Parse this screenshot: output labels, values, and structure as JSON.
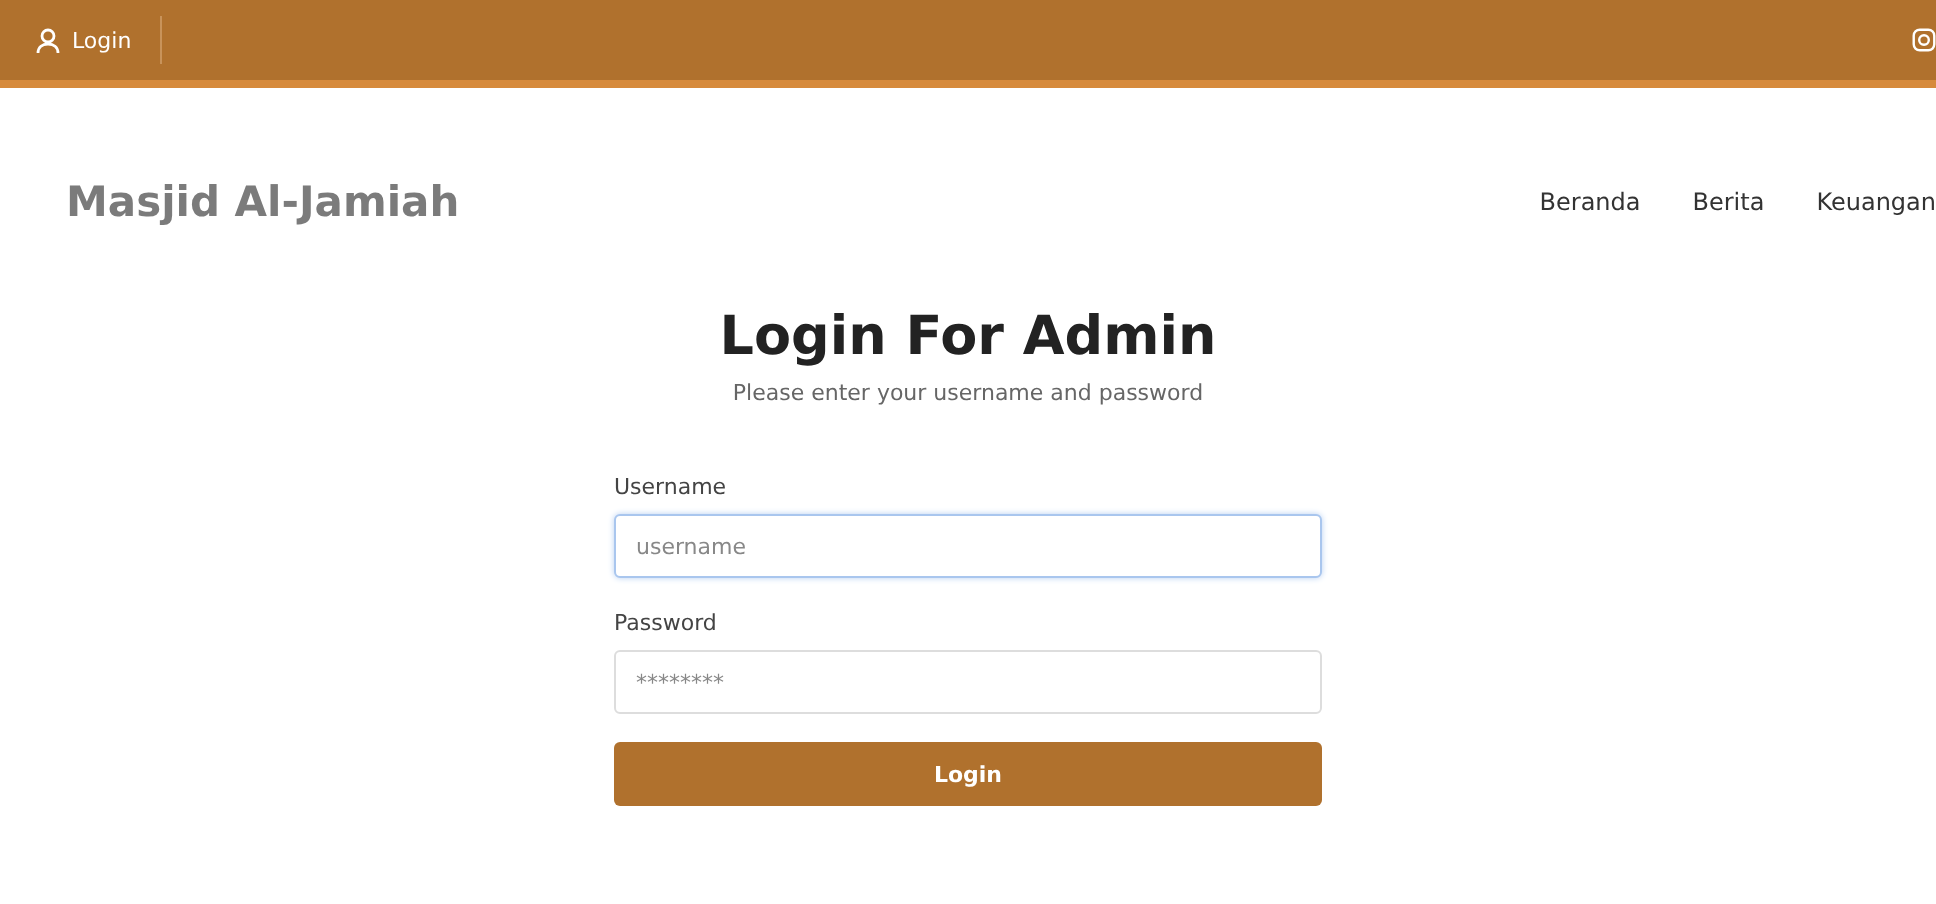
{
  "top_bar": {
    "login_link": "Login"
  },
  "header": {
    "brand": "Masjid Al-Jamiah",
    "nav": [
      {
        "label": "Beranda"
      },
      {
        "label": "Berita"
      },
      {
        "label": "Keuangan"
      }
    ]
  },
  "login_form": {
    "title": "Login For Admin",
    "subtitle": "Please enter your username and password",
    "fields": [
      {
        "label": "Username",
        "placeholder": "username",
        "focused": true
      },
      {
        "label": "Password",
        "placeholder": "********",
        "focused": false
      }
    ],
    "submit": "Login"
  }
}
